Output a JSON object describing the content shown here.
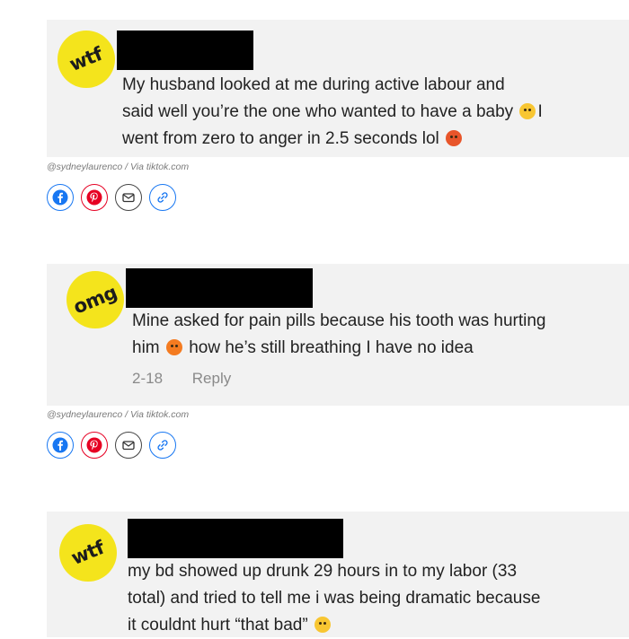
{
  "posts": [
    {
      "badge": "wtf",
      "text_lines": [
        "My husband looked at me during active labour and",
        "said well you’re the one who wanted to have a baby",
        "went from zero to anger in 2.5 seconds lol"
      ],
      "line2_tail": "I",
      "emoji_line2": "face-with-steam-emoji",
      "emoji_line3": "angry-face-emoji",
      "credit": "@sydneylaurenco / Via tiktok.com"
    },
    {
      "badge": "omg",
      "text_lines": [
        "Mine asked for pain pills because his tooth was hurting",
        "him",
        "how he’s still breathing I have no idea"
      ],
      "emoji_line2": "angry-face-emoji",
      "date": "2-18",
      "reply": "Reply",
      "credit": "@sydneylaurenco / Via tiktok.com"
    },
    {
      "badge": "wtf",
      "text_lines": [
        "my bd showed up drunk 29 hours in to my labor (33",
        "total) and tried to tell me i was being dramatic because",
        "it couldnt hurt “that bad”"
      ],
      "emoji_line3": "flushed-face-emoji"
    }
  ],
  "share_icons": [
    "facebook-icon",
    "pinterest-icon",
    "mail-icon",
    "link-icon"
  ],
  "colors": {
    "badge": "#f4e41c",
    "card": "#f2f2f2",
    "facebook": "#1877f2",
    "pinterest": "#e60023"
  }
}
